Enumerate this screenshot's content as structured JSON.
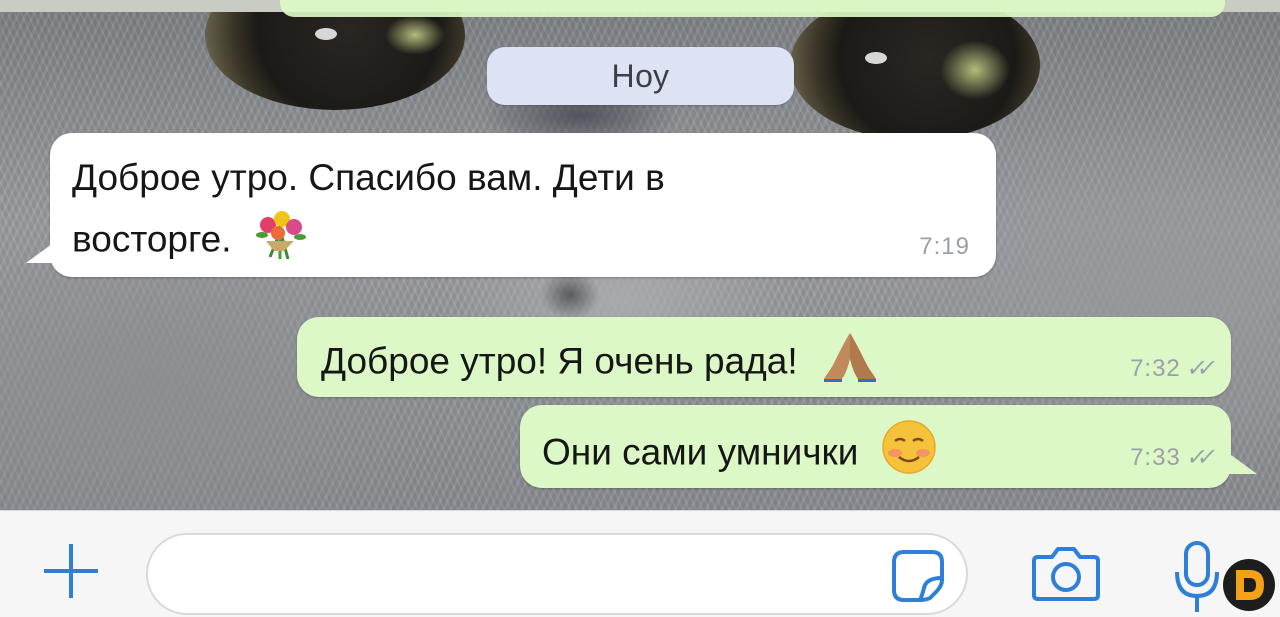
{
  "date_chip": {
    "label": "Ноу"
  },
  "messages": [
    {
      "direction": "incoming",
      "lines": [
        "Доброе утро. Спасибо вам. Дети в",
        "восторге."
      ],
      "emoji": "bouquet-emoji",
      "time": "7:19"
    },
    {
      "direction": "outgoing",
      "text": "Доброе утро! Я очень рада!",
      "emoji": "folded-hands-emoji",
      "time": "7:32",
      "status": "delivered-double-check"
    },
    {
      "direction": "outgoing",
      "text": "Они сами умнички",
      "emoji": "smiling-blush-emoji",
      "time": "7:33",
      "status": "delivered-double-check"
    }
  ],
  "input_bar": {
    "message_value": "",
    "icons": [
      "plus-icon",
      "sticker-icon",
      "camera-icon",
      "microphone-icon"
    ]
  },
  "colors": {
    "incoming_bubble": "#ffffff",
    "outgoing_bubble": "#dcf8c6",
    "date_chip": "#dde3f2",
    "accent_icons": "#2f7fd9",
    "input_bar": "#f6f6f6",
    "watermark_orange": "#f4a11a"
  }
}
